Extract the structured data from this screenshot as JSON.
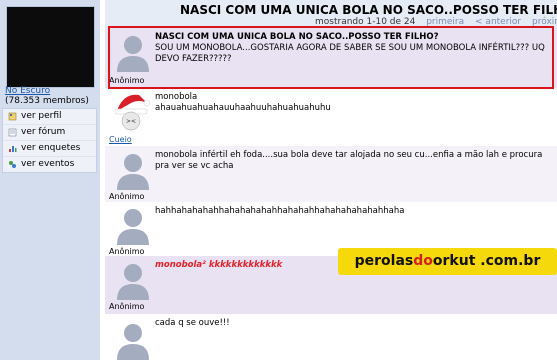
{
  "sidebar": {
    "community_name": "No Escuro",
    "community_members": "(78.353 membros)",
    "menu": [
      {
        "label": "ver perfil",
        "icon": "profile-icon"
      },
      {
        "label": "ver fórum",
        "icon": "forum-icon"
      },
      {
        "label": "ver enquetes",
        "icon": "poll-icon"
      },
      {
        "label": "ver eventos",
        "icon": "events-icon"
      }
    ]
  },
  "topic": {
    "title": "NASCI COM UMA UNICA BOLA NO SACO..POSSO TER FILHO?",
    "paging_text": "mostrando 1-10 de 24",
    "paging_links": [
      "primeira",
      "< anterior",
      "próxima >"
    ]
  },
  "posts": [
    {
      "author": "Anônimo",
      "title": "NASCI COM UMA UNICA BOLA NO SACO..POSSO TER FILHO?",
      "text": "SOU UM MONOBOLA...GOSTARIA AGORA DE SABER SE SOU UM MONOBOLA INFÉRTIL??? UQ DEVO FAZER?????"
    },
    {
      "author": "Cueio",
      "text": "monobola\nahauahuahuahauuhaahuuhahuahuahuhu"
    },
    {
      "author": "Anônimo",
      "text": "monobola infértil eh foda....sua bola deve tar alojada no seu cu...enfia a mão lah e procura pra ver se vc acha"
    },
    {
      "author": "Anônimo",
      "text": "hahhahahahahhahahahahahhahahahhahahahahahahhaha"
    },
    {
      "author": "Anônimo",
      "text": "monobola² kkkkkkkkkkkkk"
    },
    {
      "author": "",
      "text": "cada q se ouve!!!"
    }
  ],
  "watermark": {
    "part1": "perolas",
    "part2": "do",
    "part3": "orkut",
    "part4": " .com.br"
  },
  "colors": {
    "highlight": "#d9141a",
    "watermark_bg": "#f5d90a",
    "link": "#1a56b0",
    "red_text": "#e8202a"
  }
}
